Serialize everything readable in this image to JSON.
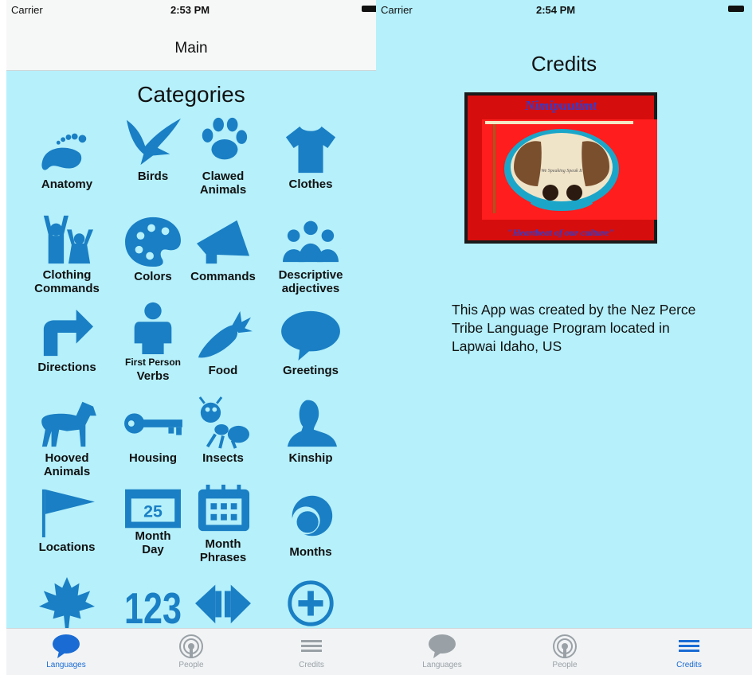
{
  "left": {
    "status": {
      "carrier": "Carrier",
      "time": "2:53 PM"
    },
    "nav": {
      "title": "Main"
    },
    "heading": "Categories",
    "categories": [
      {
        "l1": "Anatomy",
        "l2": "",
        "icon": "foot-icon"
      },
      {
        "l1": "Birds",
        "l2": "",
        "icon": "bird-icon"
      },
      {
        "l1": "Clawed",
        "l2": "Animals",
        "icon": "paw-icon"
      },
      {
        "l1": "Clothes",
        "l2": "",
        "icon": "shirt-icon"
      },
      {
        "l1": "Clothing",
        "l2": "Commands",
        "icon": "people-arms-up-icon"
      },
      {
        "l1": "Colors",
        "l2": "",
        "icon": "palette-icon"
      },
      {
        "l1": "Commands",
        "l2": "",
        "icon": "megaphone-icon"
      },
      {
        "l1": "Descriptive",
        "l2": "adjectives",
        "icon": "group-icon"
      },
      {
        "l1": "Directions",
        "l2": "",
        "icon": "turn-arrow-icon"
      },
      {
        "l1": "First Person",
        "l2": "Verbs",
        "icon": "person-icon"
      },
      {
        "l1": "Food",
        "l2": "",
        "icon": "carrot-icon"
      },
      {
        "l1": "Greetings",
        "l2": "",
        "icon": "speech-bubble-icon"
      },
      {
        "l1": "Hooved",
        "l2": "Animals",
        "icon": "horse-icon"
      },
      {
        "l1": "Housing",
        "l2": "",
        "icon": "key-icon"
      },
      {
        "l1": "Insects",
        "l2": "",
        "icon": "ant-icon"
      },
      {
        "l1": "Kinship",
        "l2": "",
        "icon": "silhouette-icon"
      },
      {
        "l1": "Locations",
        "l2": "",
        "icon": "flag-icon"
      },
      {
        "l1": "Month",
        "l2": "Day",
        "icon": "calendar-day-icon",
        "num": "25"
      },
      {
        "l1": "Month",
        "l2": "Phrases",
        "icon": "calendar-grid-icon"
      },
      {
        "l1": "Months",
        "l2": "",
        "icon": "moon-icon"
      },
      {
        "l1": "",
        "l2": "",
        "icon": "maple-leaf-icon"
      },
      {
        "l1": "",
        "l2": "",
        "icon": "numbers-icon",
        "num": "123"
      },
      {
        "l1": "",
        "l2": "",
        "icon": "left-right-arrows-icon"
      },
      {
        "l1": "",
        "l2": "",
        "icon": "plus-circle-icon"
      }
    ],
    "tabs": [
      {
        "label": "Languages",
        "icon": "speech-bubble-icon",
        "active": true
      },
      {
        "label": "People",
        "icon": "broadcast-icon",
        "active": false
      },
      {
        "label": "Credits",
        "icon": "lines-icon",
        "active": false
      }
    ]
  },
  "right": {
    "status": {
      "carrier": "Carrier",
      "time": "2:54 PM"
    },
    "heading": "Credits",
    "logo": {
      "title": "Nimipuutímt",
      "tagline": "\"Heartbeat of our culture\"",
      "inner": "We Speaking Speak It"
    },
    "credits_text": "This App was created by the Nez Perce Tribe Language Program located in Lapwai Idaho, US",
    "tabs": [
      {
        "label": "Languages",
        "icon": "speech-bubble-icon",
        "active": false
      },
      {
        "label": "People",
        "icon": "broadcast-icon",
        "active": false
      },
      {
        "label": "Credits",
        "icon": "lines-icon",
        "active": true
      }
    ]
  },
  "colors": {
    "background": "#b5f0fb",
    "icon_blue": "#1a7fc4",
    "tab_active": "#1a6bd4",
    "tab_inactive": "#9aa1a6"
  }
}
